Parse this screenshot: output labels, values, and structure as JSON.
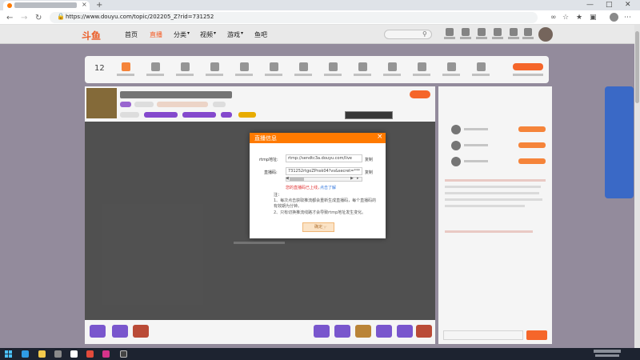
{
  "browser": {
    "url": "https://www.douyu.com/topic/202205_Z?rid=731252",
    "new_tab_label": "+",
    "tab_close": "×"
  },
  "site": {
    "logo": "斗鱼",
    "nav": [
      "首页",
      "直播",
      "分类",
      "视频",
      "游戏",
      "鱼吧"
    ],
    "active_nav_index": 1,
    "colors": {
      "accent": "#ff7a00",
      "nav_active": "#ff5d23"
    }
  },
  "toolbar": {
    "number": "12"
  },
  "modal": {
    "title": "直播信息",
    "close": "×",
    "fields": [
      {
        "label": "rtmp地址:",
        "value": "rtmp://sendtc3a.douyu.com/live",
        "action": "复制"
      },
      {
        "label": "直播码:",
        "value": "731252rtgoZPnsk04?vs&secret=*************",
        "action": "复制"
      }
    ],
    "warning": "您的直播码已上线，",
    "learn_more": "点击了解",
    "note_title": "注：",
    "notes": [
      "1、每次点击获取推流都会重新生成直播码，每个直播码的有效期为分钟。",
      "2、只有切换推流线路才会导致rtmp地址发生变化。"
    ],
    "confirm": "确定"
  }
}
